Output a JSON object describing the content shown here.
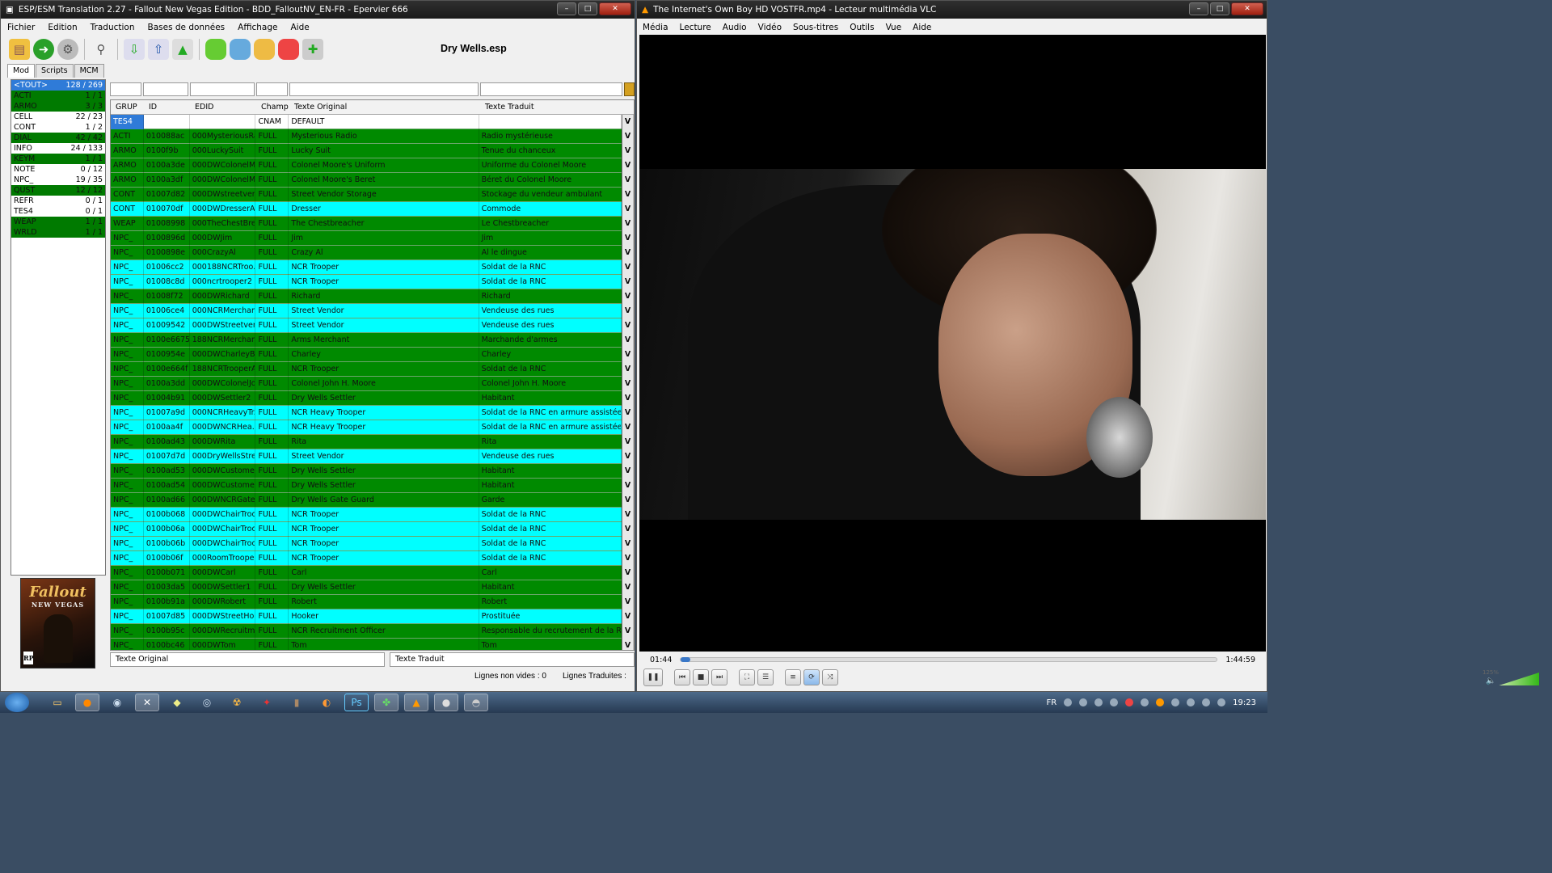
{
  "esp": {
    "title": "ESP/ESM Translation 2.27 - Fallout New Vegas Edition - BDD_FalloutNV_EN-FR - Epervier 666",
    "menu": [
      "Fichier",
      "Edition",
      "Traduction",
      "Bases de données",
      "Affichage",
      "Aide"
    ],
    "file": "Dry Wells.esp",
    "tabs": [
      "Mod",
      "Scripts",
      "MCM"
    ],
    "records": [
      {
        "name": "<TOUT>",
        "count": "128 / 269",
        "state": "sel"
      },
      {
        "name": "ACTI",
        "count": "1 / 1",
        "state": "green"
      },
      {
        "name": "ARMO",
        "count": "3 / 3",
        "state": "green"
      },
      {
        "name": "CELL",
        "count": "22 / 23",
        "state": "white"
      },
      {
        "name": "CONT",
        "count": "1 / 2",
        "state": "white"
      },
      {
        "name": "DIAL",
        "count": "42 / 42",
        "state": "green"
      },
      {
        "name": "INFO",
        "count": "24 / 133",
        "state": "white"
      },
      {
        "name": "KEYM",
        "count": "1 / 1",
        "state": "green"
      },
      {
        "name": "NOTE",
        "count": "0 / 12",
        "state": "white"
      },
      {
        "name": "NPC_",
        "count": "19 / 35",
        "state": "white"
      },
      {
        "name": "QUST",
        "count": "12 / 12",
        "state": "green"
      },
      {
        "name": "REFR",
        "count": "0 / 1",
        "state": "white"
      },
      {
        "name": "TES4",
        "count": "0 / 1",
        "state": "white"
      },
      {
        "name": "WEAP",
        "count": "1 / 1",
        "state": "green"
      },
      {
        "name": "WRLD",
        "count": "1 / 1",
        "state": "green"
      }
    ],
    "poster": {
      "title": "Fallout",
      "subtitle": "NEW VEGAS",
      "rating": "RP"
    },
    "columns": [
      "GRUP",
      "ID",
      "EDID",
      "Champ",
      "Texte Original",
      "Texte Traduit"
    ],
    "rows": [
      {
        "c": "white",
        "g": "TES4",
        "id": "",
        "edid": "",
        "f": "CNAM",
        "o": "DEFAULT",
        "t": ""
      },
      {
        "c": "green",
        "g": "ACTI",
        "id": "010088ac",
        "edid": "000MysteriousRa",
        "f": "FULL",
        "o": "Mysterious Radio",
        "t": "Radio mystérieuse"
      },
      {
        "c": "green",
        "g": "ARMO",
        "id": "0100f9b",
        "edid": "000LuckySuit",
        "f": "FULL",
        "o": "Lucky Suit",
        "t": "Tenue du chanceux"
      },
      {
        "c": "green",
        "g": "ARMO",
        "id": "0100a3de",
        "edid": "000DWColonelM...",
        "f": "FULL",
        "o": "Colonel Moore's Uniform",
        "t": "Uniforme du Colonel Moore"
      },
      {
        "c": "green",
        "g": "ARMO",
        "id": "0100a3df",
        "edid": "000DWColonelM",
        "f": "FULL",
        "o": "Colonel Moore's Beret",
        "t": "Béret du Colonel Moore"
      },
      {
        "c": "green",
        "g": "CONT",
        "id": "01007d82",
        "edid": "000DWstreetven...",
        "f": "FULL",
        "o": "Street Vendor Storage",
        "t": "Stockage du vendeur ambulant"
      },
      {
        "c": "cyan",
        "g": "CONT",
        "id": "010070df",
        "edid": "000DWDresserA...",
        "f": "FULL",
        "o": "Dresser",
        "t": "Commode"
      },
      {
        "c": "green",
        "g": "WEAP",
        "id": "01008998",
        "edid": "000TheChestBre...",
        "f": "FULL",
        "o": "The Chestbreacher",
        "t": "Le Chestbreacher"
      },
      {
        "c": "green",
        "g": "NPC_",
        "id": "0100896d",
        "edid": "000DWJim",
        "f": "FULL",
        "o": "Jim",
        "t": "Jim"
      },
      {
        "c": "green",
        "g": "NPC_",
        "id": "0100898e",
        "edid": "000CrazyAl",
        "f": "FULL",
        "o": "Crazy Al",
        "t": "Al le dingue"
      },
      {
        "c": "cyan",
        "g": "NPC_",
        "id": "01006cc2",
        "edid": "000188NCRTroo...",
        "f": "FULL",
        "o": "NCR Trooper",
        "t": "Soldat de la RNC"
      },
      {
        "c": "cyan",
        "g": "NPC_",
        "id": "01008c8d",
        "edid": "000ncrtrooper2",
        "f": "FULL",
        "o": "NCR Trooper",
        "t": "Soldat de la RNC"
      },
      {
        "c": "green",
        "g": "NPC_",
        "id": "01008f72",
        "edid": "000DWRichard",
        "f": "FULL",
        "o": "Richard",
        "t": "Richard"
      },
      {
        "c": "cyan",
        "g": "NPC_",
        "id": "01006ce4",
        "edid": "000NCRMerchant",
        "f": "FULL",
        "o": "Street Vendor",
        "t": "Vendeuse des rues"
      },
      {
        "c": "cyan",
        "g": "NPC_",
        "id": "01009542",
        "edid": "000DWStreetven...",
        "f": "FULL",
        "o": "Street Vendor",
        "t": "Vendeuse des rues"
      },
      {
        "c": "green",
        "g": "NPC_",
        "id": "0100e6675",
        "edid": "188NCRMerchant",
        "f": "FULL",
        "o": "Arms Merchant",
        "t": "Marchande d'armes"
      },
      {
        "c": "green",
        "g": "NPC_",
        "id": "0100954e",
        "edid": "000DWCharleyB...",
        "f": "FULL",
        "o": "Charley",
        "t": "Charley"
      },
      {
        "c": "green",
        "g": "NPC_",
        "id": "0100e664f",
        "edid": "188NCRTrooperA",
        "f": "FULL",
        "o": "NCR Trooper",
        "t": "Soldat de la RNC"
      },
      {
        "c": "green",
        "g": "NPC_",
        "id": "0100a3dd",
        "edid": "000DWColonelJo...",
        "f": "FULL",
        "o": "Colonel John H. Moore",
        "t": "Colonel John H. Moore"
      },
      {
        "c": "green",
        "g": "NPC_",
        "id": "01004b91",
        "edid": "000DWSettler2",
        "f": "FULL",
        "o": "Dry Wells Settler",
        "t": "Habitant"
      },
      {
        "c": "cyan",
        "g": "NPC_",
        "id": "01007a9d",
        "edid": "000NCRHeavyTr...",
        "f": "FULL",
        "o": "NCR Heavy Trooper",
        "t": "Soldat de la RNC en armure assistée"
      },
      {
        "c": "cyan",
        "g": "NPC_",
        "id": "0100aa4f",
        "edid": "000DWNCRHea...",
        "f": "FULL",
        "o": "NCR Heavy Trooper",
        "t": "Soldat de la RNC en armure assistée"
      },
      {
        "c": "green",
        "g": "NPC_",
        "id": "0100ad43",
        "edid": "000DWRita",
        "f": "FULL",
        "o": "Rita",
        "t": "Rita"
      },
      {
        "c": "cyan",
        "g": "NPC_",
        "id": "01007d7d",
        "edid": "000DryWellsStre...",
        "f": "FULL",
        "o": "Street Vendor",
        "t": "Vendeuse des rues"
      },
      {
        "c": "green",
        "g": "NPC_",
        "id": "0100ad53",
        "edid": "000DWCustomer1",
        "f": "FULL",
        "o": "Dry Wells Settler",
        "t": "Habitant"
      },
      {
        "c": "green",
        "g": "NPC_",
        "id": "0100ad54",
        "edid": "000DWCustomer2",
        "f": "FULL",
        "o": "Dry Wells Settler",
        "t": "Habitant"
      },
      {
        "c": "green",
        "g": "NPC_",
        "id": "0100ad66",
        "edid": "000DWNCRGate",
        "f": "FULL",
        "o": "Dry Wells Gate Guard",
        "t": "Garde"
      },
      {
        "c": "cyan",
        "g": "NPC_",
        "id": "0100b068",
        "edid": "000DWChairTroo...",
        "f": "FULL",
        "o": "NCR Trooper",
        "t": "Soldat de la RNC"
      },
      {
        "c": "cyan",
        "g": "NPC_",
        "id": "0100b06a",
        "edid": "000DWChairTroo...",
        "f": "FULL",
        "o": "NCR Trooper",
        "t": "Soldat de la RNC"
      },
      {
        "c": "cyan",
        "g": "NPC_",
        "id": "0100b06b",
        "edid": "000DWChairTroo...",
        "f": "FULL",
        "o": "NCR Trooper",
        "t": "Soldat de la RNC"
      },
      {
        "c": "cyan",
        "g": "NPC_",
        "id": "0100b06f",
        "edid": "000RoomTrooper1",
        "f": "FULL",
        "o": "NCR Trooper",
        "t": "Soldat de la RNC"
      },
      {
        "c": "green",
        "g": "NPC_",
        "id": "0100b071",
        "edid": "000DWCarl",
        "f": "FULL",
        "o": "Carl",
        "t": "Carl"
      },
      {
        "c": "green",
        "g": "NPC_",
        "id": "01003da5",
        "edid": "000DWSettler1",
        "f": "FULL",
        "o": "Dry Wells Settler",
        "t": "Habitant"
      },
      {
        "c": "green",
        "g": "NPC_",
        "id": "0100b91a",
        "edid": "000DWRobert",
        "f": "FULL",
        "o": "Robert",
        "t": "Robert"
      },
      {
        "c": "cyan",
        "g": "NPC_",
        "id": "01007d85",
        "edid": "000DWStreetHo...",
        "f": "FULL",
        "o": "Hooker",
        "t": "Prostituée"
      },
      {
        "c": "green",
        "g": "NPC_",
        "id": "0100b95c",
        "edid": "000DWRecruitm...",
        "f": "FULL",
        "o": "NCR Recruitment Officer",
        "t": "Responsable du recrutement de la RNC"
      },
      {
        "c": "green",
        "g": "NPC_",
        "id": "0100bc46",
        "edid": "000DWTom",
        "f": "FULL",
        "o": "Tom",
        "t": "Tom"
      }
    ],
    "vmark": "V",
    "bottom": {
      "orig": "Texte Original",
      "trad": "Texte Traduit"
    },
    "status": {
      "nonempty_label": "Lignes non vides :",
      "nonempty_value": "0",
      "translated_label": "Lignes Traduites :"
    }
  },
  "vlc": {
    "title": "The Internet's Own Boy HD VOSTFR.mp4 - Lecteur multimédia VLC",
    "menu": [
      "Média",
      "Lecture",
      "Audio",
      "Vidéo",
      "Sous-titres",
      "Outils",
      "Vue",
      "Aide"
    ],
    "elapsed": "01:44",
    "total": "1:44:59",
    "progress": 0.017,
    "volume": "125%"
  },
  "taskbar": {
    "apps": [
      "explorer",
      "firefox",
      "steam-ish",
      "esp-translator",
      "folder",
      "steam",
      "fallout",
      "arena",
      "blender",
      "vlc",
      "photoshop",
      "clover",
      "vlc-active",
      "mouse",
      "tool"
    ],
    "lang": "FR",
    "clock": "19:23"
  }
}
